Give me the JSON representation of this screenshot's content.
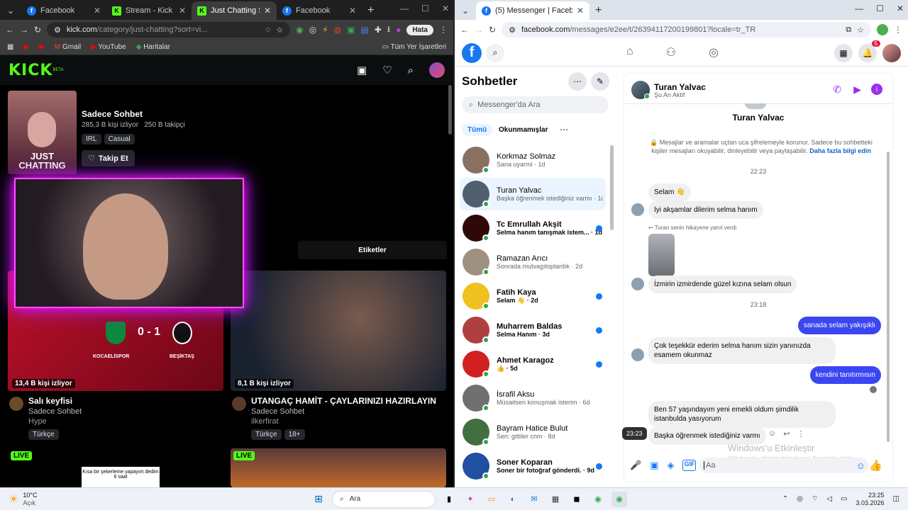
{
  "left_browser": {
    "tabs": [
      {
        "label": "Facebook",
        "icon": "facebook-icon"
      },
      {
        "label": "Stream - Kick Dashb",
        "icon": "kick-icon"
      },
      {
        "label": "Just Chatting Stream",
        "icon": "kick-icon"
      },
      {
        "label": "Facebook",
        "icon": "facebook-icon"
      }
    ],
    "url_host": "kick.com",
    "url_path": "/category/just-chatting?sort=vi...",
    "profile_label": "Hata",
    "bookmarks": [
      "Gmail",
      "YouTube",
      "Haritalar"
    ],
    "all_bookmarks": "Tüm Yer İşaretleri"
  },
  "kick": {
    "logo": "KICK",
    "logo_beta": "BETA",
    "category_img_text": "JUST CHATTING",
    "category_name": "Sadece Sohbet",
    "viewers": "285,3 B kişi izliyor",
    "followers": "250 B takipçi",
    "tags": [
      "IRL",
      "Casual"
    ],
    "follow": "Takip Et",
    "tags_header": "Etiketler",
    "streams": [
      {
        "viewers": "13,4 B kişi izliyor",
        "title": "Salı keyfisi",
        "category": "Sadece Sohbet",
        "channel": "Hype",
        "tags": [
          "Türkçe"
        ],
        "score_home": "KOCAELİSPOR",
        "score_away": "BEŞİKTAŞ",
        "score": "0 - 1"
      },
      {
        "viewers": "8,1 B kişi izliyor",
        "title": "UTANGAÇ HAMİT - ÇAYLARINIZI HAZIRLAYIN",
        "category": "Sadece Sohbet",
        "channel": "ilkerfirat",
        "tags": [
          "Türkçe",
          "18+"
        ]
      }
    ],
    "live_label": "LIVE",
    "promo_text": "Kısa bir şekerleme yapayım dedim 6 saat"
  },
  "right_browser": {
    "tabs": [
      {
        "label": "(5) Messenger | Facebook",
        "icon": "facebook-icon"
      }
    ],
    "url_host": "facebook.com",
    "url_path": "/messages/e2ee/t/26394117200199801?locale=tr_TR",
    "notif_count": "5"
  },
  "messenger": {
    "title": "Sohbetler",
    "search_placeholder": "Messenger'da Ara",
    "filters": [
      "Tümü",
      "Okunmamışlar"
    ],
    "conversations": [
      {
        "name": "Korkmaz Solmaz",
        "preview": "Sana uyarmi · 1d",
        "unread": false
      },
      {
        "name": "Turan Yalvac",
        "preview": "Başka öğrenmek istediğiniz varmı · 1d",
        "unread": false,
        "active": true
      },
      {
        "name": "Tc Emrullah Akşit",
        "preview": "Selma hanım tanışmak istem... · 1d",
        "unread": true
      },
      {
        "name": "Ramazan Arıcı",
        "preview": "Sonrada mutvagıtoplardık · 2d",
        "unread": false
      },
      {
        "name": "Fatih Kaya",
        "preview": "Selam 👋 · 2d",
        "unread": true
      },
      {
        "name": "Muharrem Baldas",
        "preview": "Selma Hanım · 3d",
        "unread": true
      },
      {
        "name": "Ahmet Karagoz",
        "preview": "👍 · 5d",
        "unread": true
      },
      {
        "name": "İsrafil Aksu",
        "preview": "Müsaitsen konuşmak isterim · 6d",
        "unread": false
      },
      {
        "name": "Bayram Hatice Bulut",
        "preview": "Sen: gittiler cnm · 8d",
        "unread": false
      },
      {
        "name": "Soner Koparan",
        "preview": "Soner bir fotoğraf gönderdi. · 9d",
        "unread": true
      }
    ],
    "chat": {
      "name": "Turan Yalvac",
      "status": "Şu An Aktif",
      "profile_name": "Turan Yalvac",
      "e2ee_notice": "Mesajlar ve aramalar uçtan uca şifrelemeyle korunur. Sadece bu sohbetteki kişiler mesajları okuyabilir, dinleyebilir veya paylaşabilir.",
      "e2ee_link": "Daha fazla bilgi edin",
      "time1": "22:23",
      "time2": "23:18",
      "m1": "Selam 👋",
      "m2": "Iyi akşamlar dilerim selma hanım",
      "story_reply": "Turan senin hikayene yanıt verdi",
      "m3": "İzmirin izmirdende güzel kızına selam olsun",
      "m4": "sanada selam yakışıklı",
      "m5": "Çok teşekkür ederim selma hanım sizin yanınızda esamem okunmaz",
      "m6": "kendini tanıtırmısın",
      "m7": "Ben 57 yaşındayım yeni emekli oldum şimdilik istanbulda yasıyorum",
      "m8": "Başka öğrenmek istediğiniz varmı",
      "hover_time": "23:23",
      "input_placeholder": "Aa",
      "watermark_title": "Windows'u Etkinleştir",
      "watermark_sub": "Windows'u etkinleştirmek için Ayarlar'a gidin."
    }
  },
  "taskbar": {
    "weather_temp": "10°C",
    "weather_desc": "Açık",
    "search": "Ara",
    "time": "23:25",
    "date": "3.03.2026"
  }
}
